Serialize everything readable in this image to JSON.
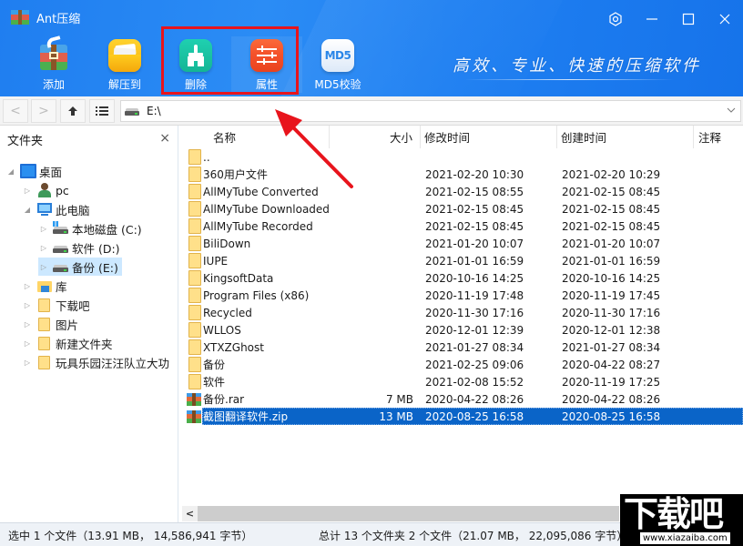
{
  "app": {
    "title": "Ant压缩",
    "slogan": "高效、专业、快速的压缩软件",
    "window_controls": {
      "settings_icon": "hexagon-gear-icon",
      "minimize_icon": "minimize-icon",
      "maximize_icon": "maximize-icon",
      "close_icon": "close-icon"
    }
  },
  "toolbar": {
    "buttons": [
      {
        "label": "添加",
        "icon": "add-archive-icon"
      },
      {
        "label": "解压到",
        "icon": "extract-folder-icon"
      },
      {
        "label": "删除",
        "icon": "broom-delete-icon"
      },
      {
        "label": "属性",
        "icon": "sliders-properties-icon"
      },
      {
        "label": "MD5校验",
        "icon": "md5-icon",
        "icon_text": "MD5"
      }
    ],
    "highlighted": [
      "删除",
      "属性"
    ],
    "highlight_color": "#e8141c"
  },
  "navbar": {
    "back_icon": "<",
    "forward_icon": ">",
    "up_icon": "↑",
    "view_icon": "☰",
    "address": "E:\\"
  },
  "sidebar": {
    "title": "文件夹",
    "close": "×",
    "tree": [
      {
        "label": "桌面",
        "level": 0,
        "expanded": true,
        "icon": "desktop-icon"
      },
      {
        "label": "pc",
        "level": 1,
        "expanded": false,
        "icon": "user-icon"
      },
      {
        "label": "此电脑",
        "level": 1,
        "expanded": true,
        "icon": "computer-icon"
      },
      {
        "label": "本地磁盘 (C:)",
        "level": 2,
        "expanded": false,
        "icon": "system-drive-icon"
      },
      {
        "label": "软件 (D:)",
        "level": 2,
        "expanded": false,
        "icon": "drive-icon"
      },
      {
        "label": "备份 (E:)",
        "level": 2,
        "expanded": false,
        "icon": "drive-icon",
        "selected": true
      },
      {
        "label": "库",
        "level": 1,
        "expanded": false,
        "icon": "library-icon"
      },
      {
        "label": "下载吧",
        "level": 1,
        "expanded": false,
        "icon": "folder-icon"
      },
      {
        "label": "图片",
        "level": 1,
        "expanded": false,
        "icon": "folder-icon"
      },
      {
        "label": "新建文件夹",
        "level": 1,
        "expanded": false,
        "icon": "folder-icon"
      },
      {
        "label": "玩具乐园汪汪队立大功",
        "level": 1,
        "expanded": false,
        "icon": "folder-icon"
      }
    ]
  },
  "filelist": {
    "columns": [
      "名称",
      "大小",
      "修改时间",
      "创建时间",
      "注释"
    ],
    "rows": [
      {
        "name": "..",
        "size": "",
        "modified": "",
        "created": "",
        "type": "folder"
      },
      {
        "name": "360用户文件",
        "size": "",
        "modified": "2021-02-20 10:30",
        "created": "2021-02-20 10:29",
        "type": "folder"
      },
      {
        "name": "AllMyTube Converted",
        "size": "",
        "modified": "2021-02-15 08:55",
        "created": "2021-02-15 08:45",
        "type": "folder"
      },
      {
        "name": "AllMyTube Downloaded",
        "size": "",
        "modified": "2021-02-15 08:45",
        "created": "2021-02-15 08:45",
        "type": "folder"
      },
      {
        "name": "AllMyTube Recorded",
        "size": "",
        "modified": "2021-02-15 08:45",
        "created": "2021-02-15 08:45",
        "type": "folder"
      },
      {
        "name": "BiliDown",
        "size": "",
        "modified": "2021-01-20 10:07",
        "created": "2021-01-20 10:07",
        "type": "folder"
      },
      {
        "name": "IUPE",
        "size": "",
        "modified": "2021-01-01 16:59",
        "created": "2021-01-01 16:59",
        "type": "folder"
      },
      {
        "name": "KingsoftData",
        "size": "",
        "modified": "2020-10-16 14:25",
        "created": "2020-10-16 14:25",
        "type": "folder"
      },
      {
        "name": "Program Files (x86)",
        "size": "",
        "modified": "2020-11-19 17:48",
        "created": "2020-11-19 17:45",
        "type": "folder"
      },
      {
        "name": "Recycled",
        "size": "",
        "modified": "2020-11-30 17:16",
        "created": "2020-11-30 17:16",
        "type": "folder"
      },
      {
        "name": "WLLOS",
        "size": "",
        "modified": "2020-12-01 12:39",
        "created": "2020-12-01 12:38",
        "type": "folder"
      },
      {
        "name": "XTXZGhost",
        "size": "",
        "modified": "2021-01-27 08:34",
        "created": "2021-01-27 08:34",
        "type": "folder"
      },
      {
        "name": "备份",
        "size": "",
        "modified": "2021-02-25 09:06",
        "created": "2020-04-22 08:27",
        "type": "folder"
      },
      {
        "name": "软件",
        "size": "",
        "modified": "2021-02-08 15:52",
        "created": "2020-11-19 17:25",
        "type": "folder"
      },
      {
        "name": "备份.rar",
        "size": "7 MB",
        "modified": "2020-04-22 08:26",
        "created": "2020-04-22 08:26",
        "type": "archive"
      },
      {
        "name": "截图翻译软件.zip",
        "size": "13 MB",
        "modified": "2020-08-25 16:58",
        "created": "2020-08-25 16:58",
        "type": "archive",
        "selected": true
      }
    ],
    "selection_color": "#0a64c8",
    "scroll_left": "<"
  },
  "statusbar": {
    "selected": "选中 1 个文件（13.91 MB， 14,586,941 字节）",
    "total": "总计 13 个文件夹 2 个文件（21.07 MB， 22,095,086 字节）"
  },
  "watermark": {
    "text": "下载吧",
    "url": "www.xiazaiba.com"
  }
}
